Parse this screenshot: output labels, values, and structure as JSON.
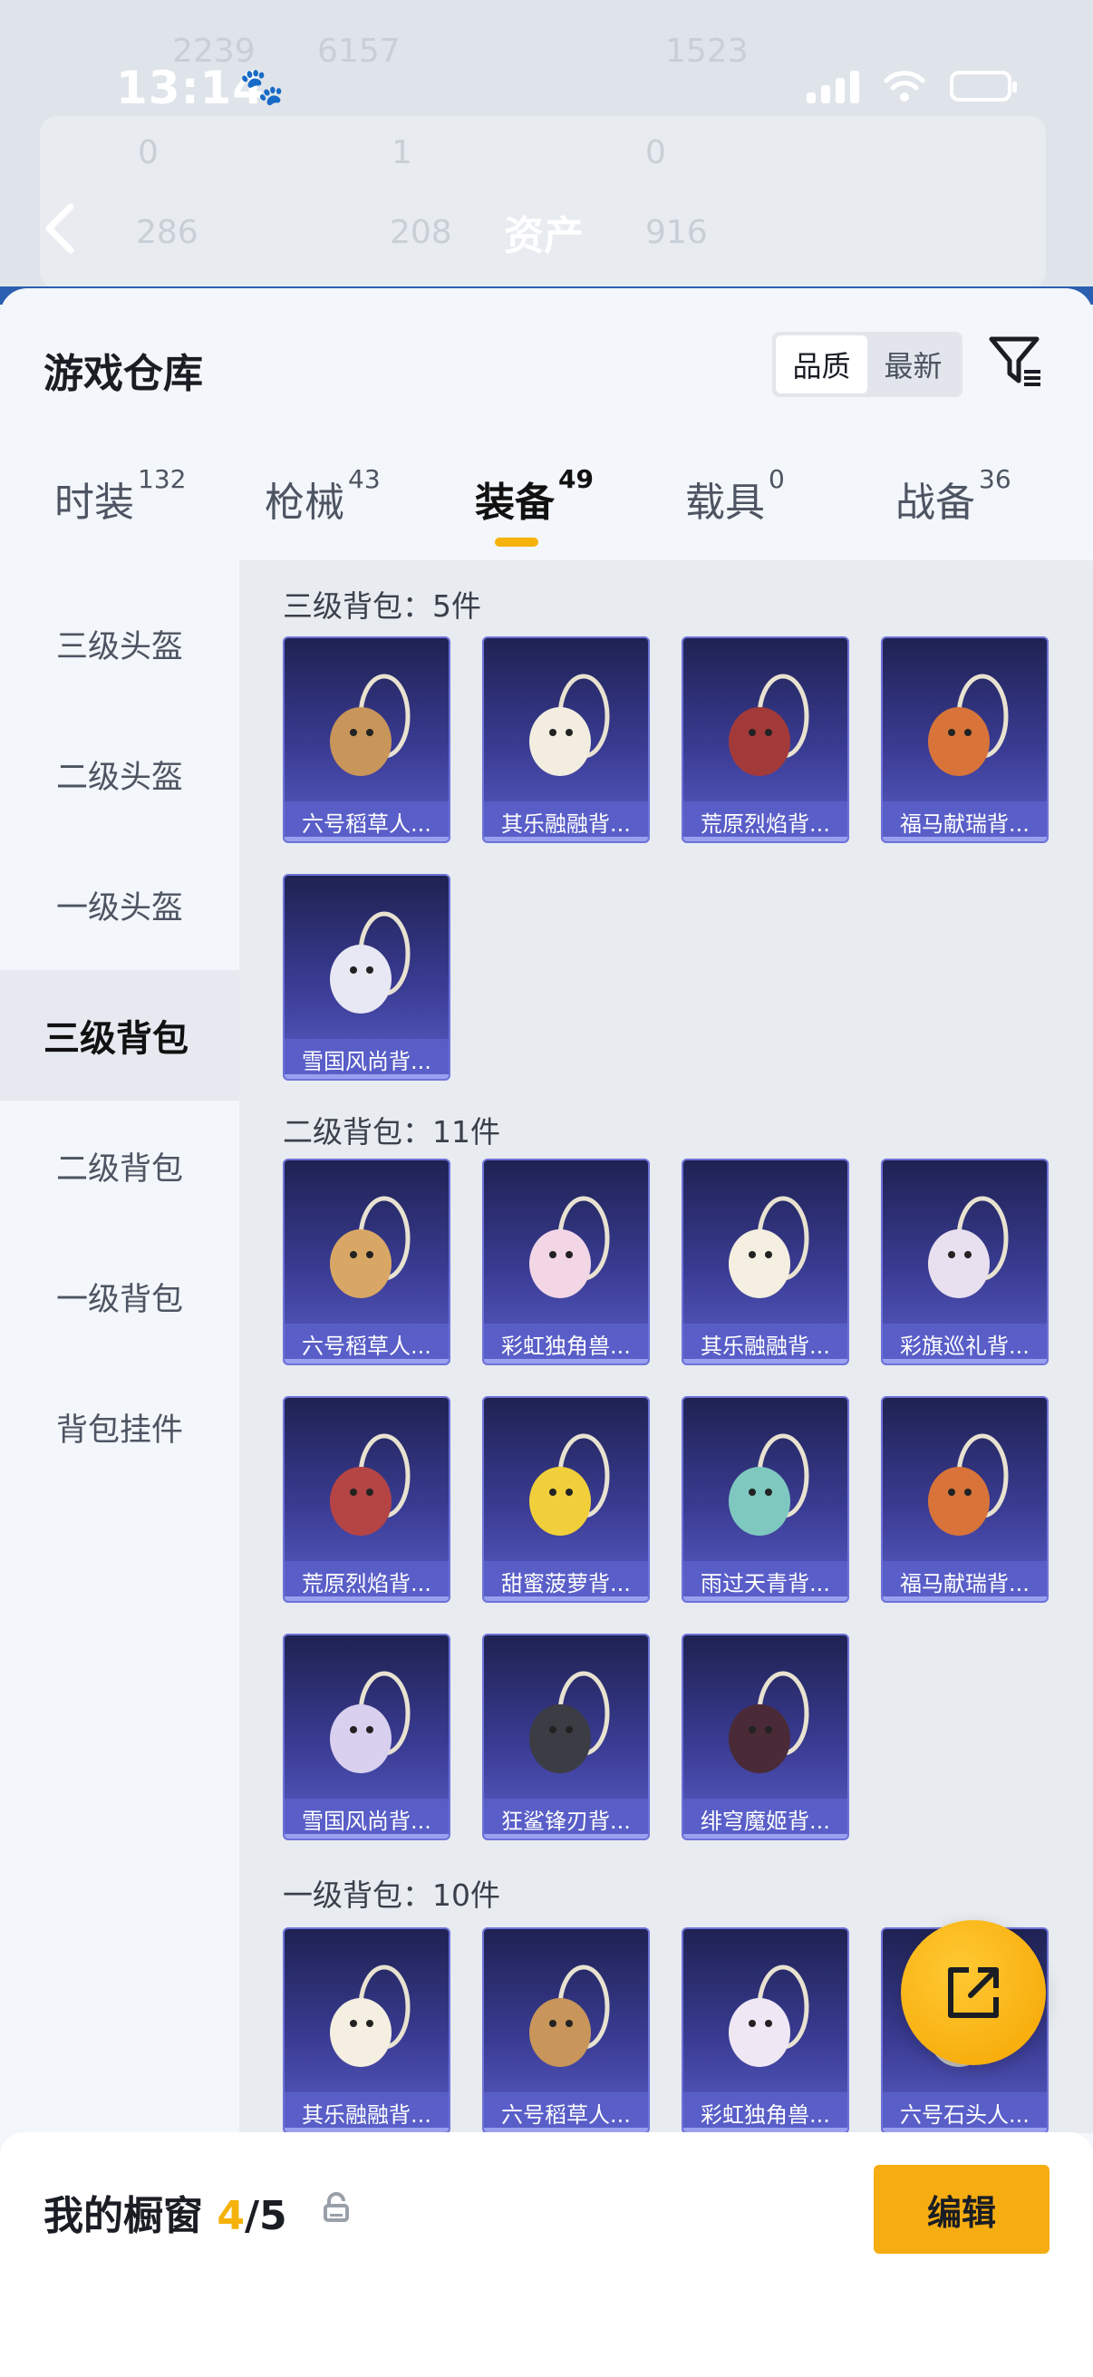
{
  "status_bar": {
    "time": "13:14"
  },
  "header": {
    "title": "资产"
  },
  "backdrop": {
    "texts": [
      "2239",
      "6157",
      "1523",
      "0",
      "1",
      "0",
      "286",
      "208",
      "916"
    ]
  },
  "sheet": {
    "title": "游戏仓库",
    "sort": {
      "options": [
        "品质",
        "最新"
      ],
      "selected": "品质"
    }
  },
  "tabs": [
    {
      "label": "时装",
      "count": "132"
    },
    {
      "label": "枪械",
      "count": "43"
    },
    {
      "label": "装备",
      "count": "49",
      "active": true
    },
    {
      "label": "载具",
      "count": "0"
    },
    {
      "label": "战备",
      "count": "36"
    }
  ],
  "categories": [
    "三级头盔",
    "二级头盔",
    "一级头盔",
    "三级背包",
    "二级背包",
    "一级背包",
    "背包挂件"
  ],
  "active_category": "三级背包",
  "sections": [
    {
      "title": "三级背包：5件",
      "items": [
        "六号稻草人...",
        "其乐融融背...",
        "荒原烈焰背...",
        "福马献瑞背...",
        "雪国风尚背..."
      ]
    },
    {
      "title": "二级背包：11件",
      "items": [
        "六号稻草人...",
        "彩虹独角兽...",
        "其乐融融背...",
        "彩旗巡礼背...",
        "荒原烈焰背...",
        "甜蜜菠萝背...",
        "雨过天青背...",
        "福马献瑞背...",
        "雪国风尚背...",
        "狂鲨锋刃背...",
        "绯穹魔姬背..."
      ]
    },
    {
      "title": "一级背包：10件",
      "items": [
        "其乐融融背...",
        "六号稻草人...",
        "彩虹独角兽...",
        "六号石头人..."
      ]
    }
  ],
  "bottom": {
    "label": "我的橱窗",
    "current": "4",
    "total": "/5",
    "edit_label": "编辑"
  },
  "colors": {
    "accent": "#f5b20a",
    "card_bg": "#3a3c94"
  }
}
